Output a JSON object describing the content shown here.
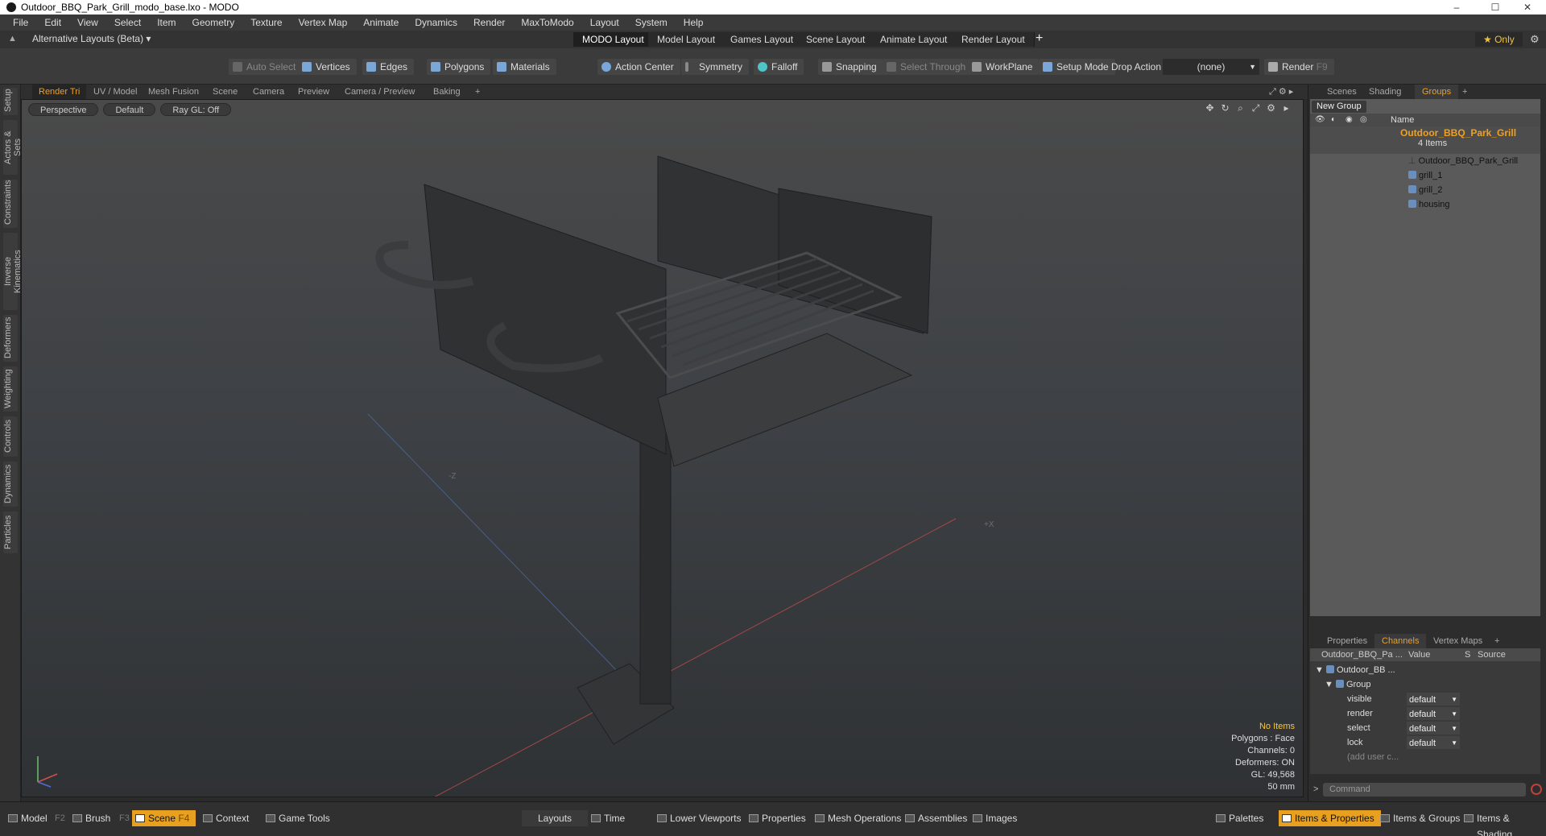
{
  "window": {
    "title": "Outdoor_BBQ_Park_Grill_modo_base.lxo - MODO",
    "minimize": "–",
    "maximize": "☐",
    "close": "✕"
  },
  "menu": [
    "File",
    "Edit",
    "View",
    "Select",
    "Item",
    "Geometry",
    "Texture",
    "Vertex Map",
    "Animate",
    "Dynamics",
    "Render",
    "MaxToModo",
    "Layout",
    "System",
    "Help"
  ],
  "layoutbar": {
    "alt_layouts": "Alternative Layouts (Beta) ▾",
    "tabs": [
      "MODO Layout",
      "Model Layout",
      "Games Layout",
      "Scene Layout",
      "Animate Layout",
      "Render Layout"
    ],
    "add": "+",
    "only": "★  Only"
  },
  "toolbar": {
    "auto_select": "Auto Select",
    "vertices": "Vertices",
    "edges": "Edges",
    "polygons": "Polygons",
    "materials": "Materials",
    "action_center": "Action Center",
    "symmetry": "Symmetry",
    "falloff": "Falloff",
    "snapping": "Snapping",
    "select_through": "Select Through",
    "workplane": "WorkPlane",
    "setup_mode": "Setup Mode",
    "drop_action": "Drop Action",
    "drop_value": "(none)",
    "render": "Render",
    "render_key": "F9"
  },
  "lefttabs": [
    "Setup",
    "Actors & Sets",
    "Constraints",
    "Inverse Kinematics",
    "Deformers",
    "Weighting",
    "Controls",
    "Dynamics",
    "Particles"
  ],
  "viewport_tabs": [
    "Render Tri",
    "UV / Model",
    "Mesh Fusion",
    "Scene",
    "Camera",
    "Preview",
    "Camera / Preview",
    "Baking",
    "+"
  ],
  "viewport": {
    "view": "Perspective",
    "shading": "Default",
    "raygl": "Ray GL: Off",
    "info": {
      "items": "No Items",
      "polygons": "Polygons : Face",
      "channels": "Channels: 0",
      "deformers": "Deformers: ON",
      "gl": "GL: 49,568",
      "focal": "50 mm"
    },
    "axis_minus_z": "-Z",
    "axis_plus_x": "+X"
  },
  "rightpanel": {
    "tabs": [
      "Scenes",
      "Shading",
      "Groups",
      "+"
    ],
    "new_group": "New Group",
    "name_col": "Name",
    "group": {
      "name": "Outdoor_BBQ_Park_Grill",
      "count": "4 Items",
      "children": [
        "Outdoor_BBQ_Park_Grill",
        "grill_1",
        "grill_2",
        "housing"
      ]
    },
    "lower_tabs": [
      "Properties",
      "Channels",
      "Vertex Maps",
      "+"
    ],
    "channels": {
      "col_item": "Outdoor_BBQ_Pa ...",
      "col_value": "Value",
      "col_s": "S",
      "col_source": "Source",
      "root": "Outdoor_BB ...",
      "group": "Group",
      "rows": [
        {
          "name": "visible",
          "value": "default"
        },
        {
          "name": "render",
          "value": "default"
        },
        {
          "name": "select",
          "value": "default"
        },
        {
          "name": "lock",
          "value": "default"
        }
      ],
      "add_user": "(add user c..."
    },
    "command_placeholder": "Command"
  },
  "statusbar": {
    "model": "Model",
    "model_key": "F2",
    "brush": "Brush",
    "brush_key": "F3",
    "scene": "Scene",
    "scene_key": "F4",
    "context": "Context",
    "game_tools": "Game Tools",
    "layouts": "Layouts",
    "time": "Time",
    "lower_viewports": "Lower Viewports",
    "properties": "Properties",
    "mesh_operations": "Mesh Operations",
    "assemblies": "Assemblies",
    "images": "Images",
    "palettes": "Palettes",
    "items_properties": "Items & Properties",
    "items_groups": "Items & Groups",
    "items_shading": "Items & Shading"
  }
}
